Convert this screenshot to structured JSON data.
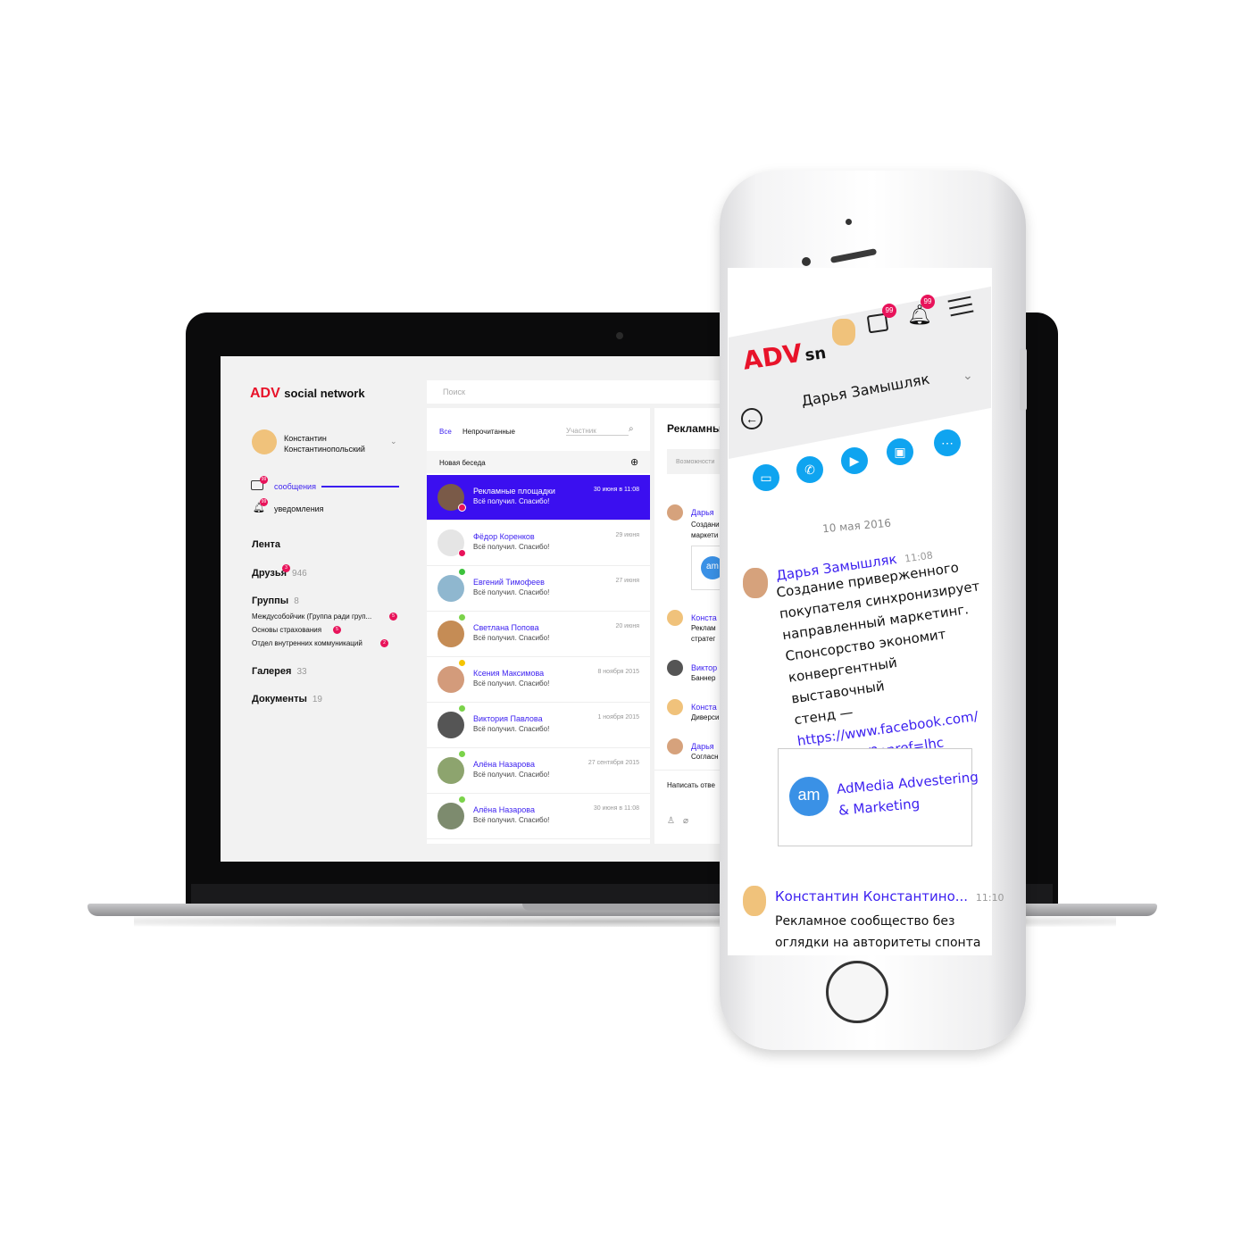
{
  "desktop": {
    "logo_brand": "ADV",
    "logo_text": "social network",
    "user_name_line1": "Константин",
    "user_name_line2": "Константинопольский",
    "nav_messages": "сообщения",
    "nav_notifications": "уведомления",
    "nav_badge": "99",
    "menu": [
      {
        "label": "Лента",
        "count": ""
      },
      {
        "label": "Друзья",
        "count": "946",
        "badge": "3"
      },
      {
        "label": "Группы",
        "count": "8"
      },
      {
        "label": "Галерея",
        "count": "33"
      },
      {
        "label": "Документы",
        "count": "19"
      }
    ],
    "groups": [
      {
        "label": "Междусобойчик (Группа ради груп...",
        "badge": "5"
      },
      {
        "label": "Основы страхования",
        "badge": "5"
      },
      {
        "label": "Отдел внутренних коммуникаций",
        "badge": "2"
      }
    ],
    "search_placeholder": "Поиск",
    "tab_all": "Все",
    "tab_unread": "Непрочитанные",
    "participant_placeholder": "Участник",
    "new_chat": "Новая беседа",
    "conversations": [
      {
        "name": "Рекламные площадки",
        "msg": "Всё получил. Спасибо!",
        "date": "30 июня в 11:08",
        "badge": "3"
      },
      {
        "name": "Фёдор Коренков",
        "msg": "Всё получил. Спасибо!",
        "date": "29 июня",
        "badge": "1"
      },
      {
        "name": "Евгений Тимофеев",
        "msg": "Всё получил. Спасибо!",
        "date": "27 июня"
      },
      {
        "name": "Светлана Попова",
        "msg": "Всё получил. Спасибо!",
        "date": "20 июня"
      },
      {
        "name": "Ксения Максимова",
        "msg": "Всё получил. Спасибо!",
        "date": "8 ноября 2015"
      },
      {
        "name": "Виктория Павлова",
        "msg": "Всё получил. Спасибо!",
        "date": "1 ноября 2015"
      },
      {
        "name": "Алёна Назарова",
        "msg": "Всё получил. Спасибо!",
        "date": "27 сентября 2015"
      },
      {
        "name": "Алёна Назарова",
        "msg": "Всё получил. Спасибо!",
        "date": "30 июня в 11:08"
      }
    ],
    "chat_title": "Рекламны",
    "chat_input_placeholder": "Возможности",
    "chat_items": [
      {
        "name": "Дарья",
        "lines": [
          "Создани",
          "маркети"
        ]
      },
      {
        "name": "Конста",
        "lines": [
          "Реклам",
          "стратег"
        ]
      },
      {
        "name": "Виктор",
        "lines": [
          "Баннер"
        ]
      },
      {
        "name": "Конста",
        "lines": [
          "Диверси"
        ]
      },
      {
        "name": "Дарья",
        "lines": [
          "Согласн"
        ]
      }
    ],
    "chat_reply": "Написать отве",
    "card_logo": "am"
  },
  "mobile": {
    "logo_brand": "ADV",
    "logo_suffix": "sn",
    "msg_badge": "99",
    "notif_badge": "99",
    "contact_name": "Дарья Замышляк",
    "date_label": "10 мая 2016",
    "message1": {
      "name": "Дарья Замышляк",
      "time": "11:08",
      "lines": [
        "Создание приверженного",
        "покупателя синхронизирует",
        "направленный маркетинг.",
        "Спонсорство экономит",
        "конвергентный выставочный"
      ],
      "line_last_prefix": "стенд —",
      "link_part1": "https://www.facebook.com/",
      "link_part2": "advamam/?pnref=lhc"
    },
    "card": {
      "logo": "am",
      "title_line1": "AdMedia Advestering",
      "title_line2": "& Marketing"
    },
    "message2": {
      "name": "Константин Константино...",
      "time": "11:10",
      "lines": [
        "Рекламное сообщество без",
        "оглядки на авторитеты спонтанно"
      ]
    },
    "colors": {
      "accent": "#3b1ff0",
      "brand": "#e8132a",
      "action": "#0fa4f0",
      "badge": "#e8135a"
    }
  }
}
